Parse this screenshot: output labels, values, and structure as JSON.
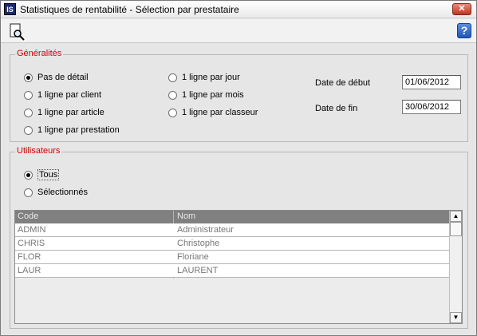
{
  "window": {
    "icon_text": "IS",
    "title": "Statistiques de rentabilité - Sélection par prestataire",
    "close_label": "✕"
  },
  "toolbar": {
    "help_label": "?"
  },
  "generalites": {
    "legend": "Généralités",
    "options": [
      {
        "label": "Pas de détail",
        "selected": true
      },
      {
        "label": "1 ligne par client",
        "selected": false
      },
      {
        "label": "1 ligne par article",
        "selected": false
      },
      {
        "label": "1 ligne par prestation",
        "selected": false
      },
      {
        "label": "1 ligne par jour",
        "selected": false
      },
      {
        "label": "1 ligne par mois",
        "selected": false
      },
      {
        "label": "1 ligne par classeur",
        "selected": false
      }
    ],
    "date_debut_label": "Date de début",
    "date_debut_value": "01/06/2012",
    "date_fin_label": "Date de fin",
    "date_fin_value": "30/06/2012"
  },
  "utilisateurs": {
    "legend": "Utilisateurs",
    "options": [
      {
        "label": "Tous",
        "selected": true
      },
      {
        "label": "Sélectionnés",
        "selected": false
      }
    ],
    "columns": [
      "Code",
      "Nom"
    ],
    "rows": [
      [
        "ADMIN",
        "Administrateur"
      ],
      [
        "CHRIS",
        "Christophe"
      ],
      [
        "FLOR",
        "Floriane"
      ],
      [
        "LAUR",
        "LAURENT"
      ]
    ]
  },
  "scrollbar": {
    "up": "▲",
    "down": "▼"
  }
}
